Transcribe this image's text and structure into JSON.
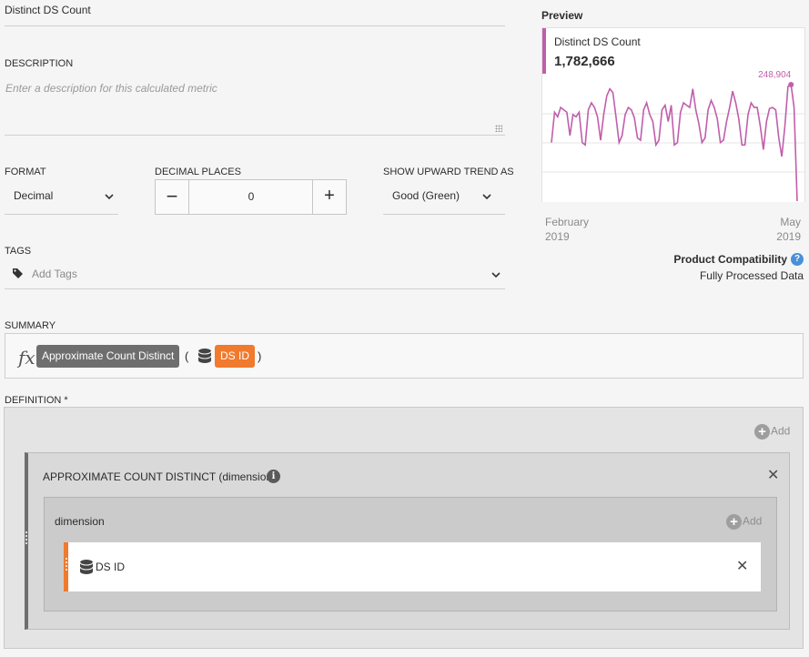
{
  "title_field": {
    "value": "Distinct DS Count"
  },
  "description": {
    "label": "DESCRIPTION",
    "placeholder": "Enter a description for this calculated metric"
  },
  "format": {
    "label": "FORMAT",
    "value": "Decimal"
  },
  "decimal_places": {
    "label": "DECIMAL PLACES",
    "value": "0",
    "minus": "−",
    "plus": "+"
  },
  "trend": {
    "label": "SHOW UPWARD TREND AS",
    "value": "Good (Green)"
  },
  "tags": {
    "label": "TAGS",
    "placeholder": "Add Tags"
  },
  "preview": {
    "title": "Preview",
    "metric_name": "Distinct DS Count",
    "total": "1,782,666",
    "x_start": "February\n2019",
    "x_end": "May\n2019",
    "accent_color": "#c15eab"
  },
  "compatibility": {
    "label": "Product Compatibility",
    "value": "Fully Processed Data",
    "help_icon": "question-icon"
  },
  "summary": {
    "label": "SUMMARY",
    "fx": "fx",
    "function_name": "Approximate Count Distinct",
    "paren_open": "(",
    "dimension": "DS ID",
    "paren_close": ")"
  },
  "definition": {
    "label": "DEFINITION *",
    "add_label": "Add",
    "function_title": "APPROXIMATE COUNT DISTINCT (dimension)",
    "info_icon": "i",
    "dimension_title": "dimension",
    "dimension_item": "DS ID",
    "close_glyph": "✕"
  },
  "chart_data": {
    "type": "line",
    "title": "",
    "xlabel": "",
    "ylabel": "",
    "x_range": [
      "February 2019",
      "May 2019"
    ],
    "ylim": [
      0,
      248904
    ],
    "max_label": "248,904",
    "values": [
      125000,
      190000,
      180000,
      200000,
      195000,
      190000,
      140000,
      185000,
      180000,
      190000,
      125000,
      120000,
      195000,
      210000,
      200000,
      180000,
      130000,
      185000,
      225000,
      240000,
      232000,
      180000,
      125000,
      140000,
      185000,
      200000,
      195000,
      178000,
      135000,
      130000,
      195000,
      210000,
      185000,
      170000,
      120000,
      130000,
      195000,
      205000,
      170000,
      205000,
      120000,
      125000,
      190000,
      210000,
      205000,
      200000,
      240000,
      195000,
      165000,
      125000,
      135000,
      195000,
      215000,
      200000,
      175000,
      125000,
      130000,
      170000,
      200000,
      235000,
      210000,
      175000,
      120000,
      120000,
      185000,
      210000,
      200000,
      200000,
      160000,
      110000,
      170000,
      198000,
      200000,
      195000,
      135000,
      95000,
      160000,
      245000,
      248904,
      200000,
      0
    ],
    "colors": {
      "line": "#c15eab",
      "grid": "#e6e6e6"
    },
    "grid": true
  }
}
